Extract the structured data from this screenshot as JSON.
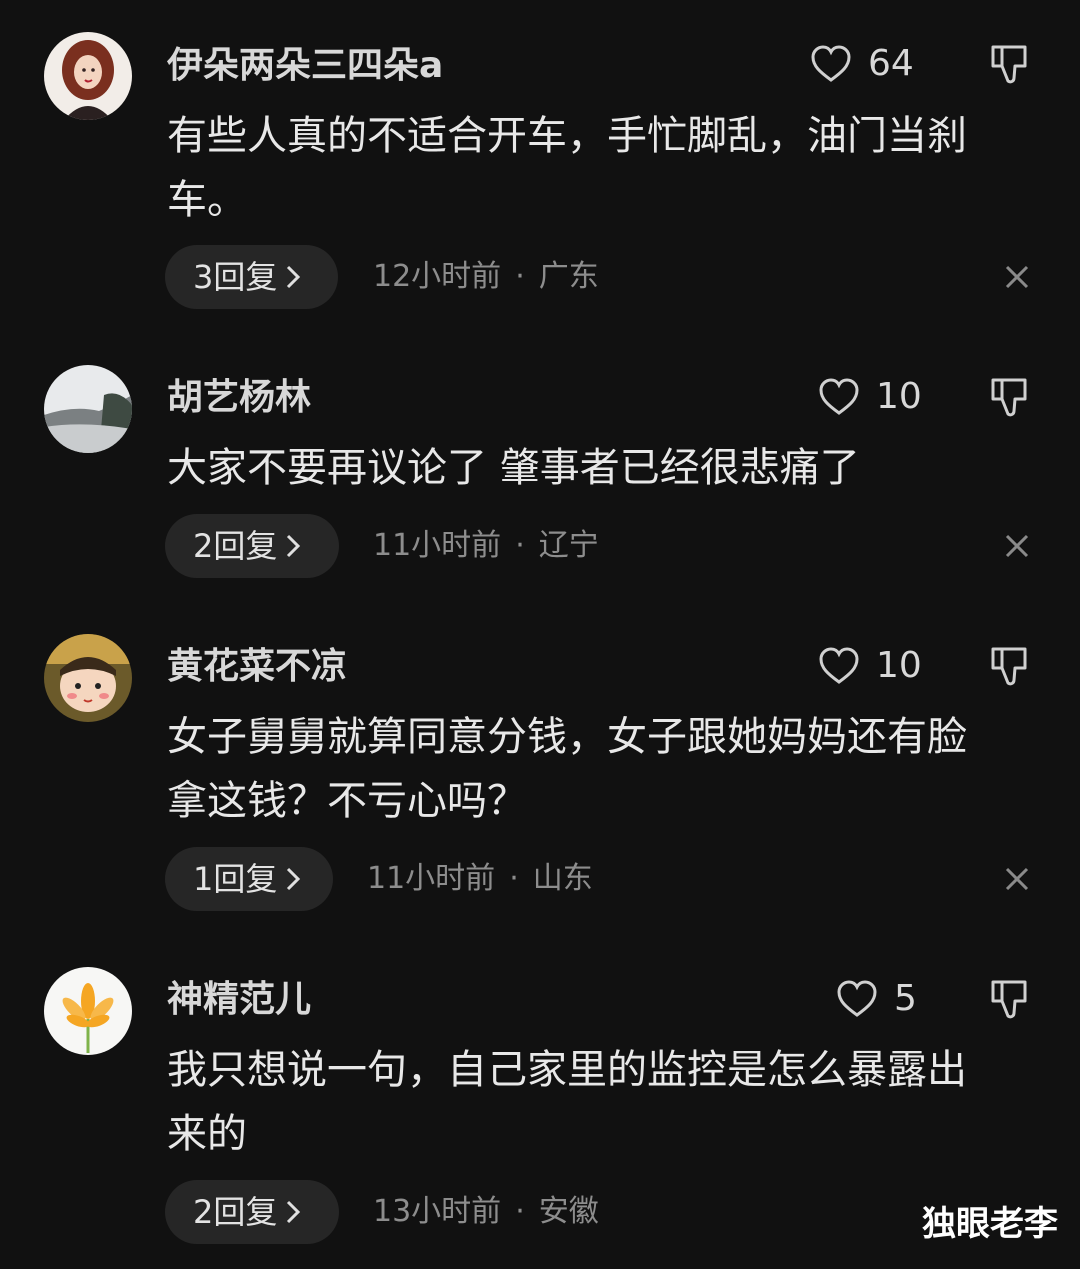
{
  "comments": [
    {
      "username": "伊朵两朵三四朵a",
      "likes": "64",
      "content_lines": [
        "有些人真的不适合开车，手忙脚乱，油门当刹",
        "车。"
      ],
      "replies": "3回复",
      "time": "12小时前",
      "separator": "·",
      "location": "广东",
      "avatar_icon": "avatar-portrait-woman-icon"
    },
    {
      "username": "胡艺杨林",
      "likes": "10",
      "content_lines": [
        "大家不要再议论了 肇事者已经很悲痛了"
      ],
      "replies": "2回复",
      "time": "11小时前",
      "separator": "·",
      "location": "辽宁",
      "avatar_icon": "avatar-landscape-icon"
    },
    {
      "username": "黄花菜不凉",
      "likes": "10",
      "content_lines": [
        "女子舅舅就算同意分钱，女子跟她妈妈还有脸",
        "拿这钱？不亏心吗？"
      ],
      "replies": "1回复",
      "time": "11小时前",
      "separator": "·",
      "location": "山东",
      "avatar_icon": "avatar-cartoon-child-icon"
    },
    {
      "username": "神精范儿",
      "likes": "5",
      "content_lines": [
        "我只想说一句，自己家里的监控是怎么暴露出",
        "来的"
      ],
      "replies": "2回复",
      "time": "13小时前",
      "separator": "·",
      "location": "安徽",
      "avatar_icon": "avatar-flower-icon"
    }
  ],
  "watermark": "独眼老李",
  "colors": {
    "background": "#111111",
    "pill": "#262626",
    "meta_text": "#8d8d8d"
  }
}
